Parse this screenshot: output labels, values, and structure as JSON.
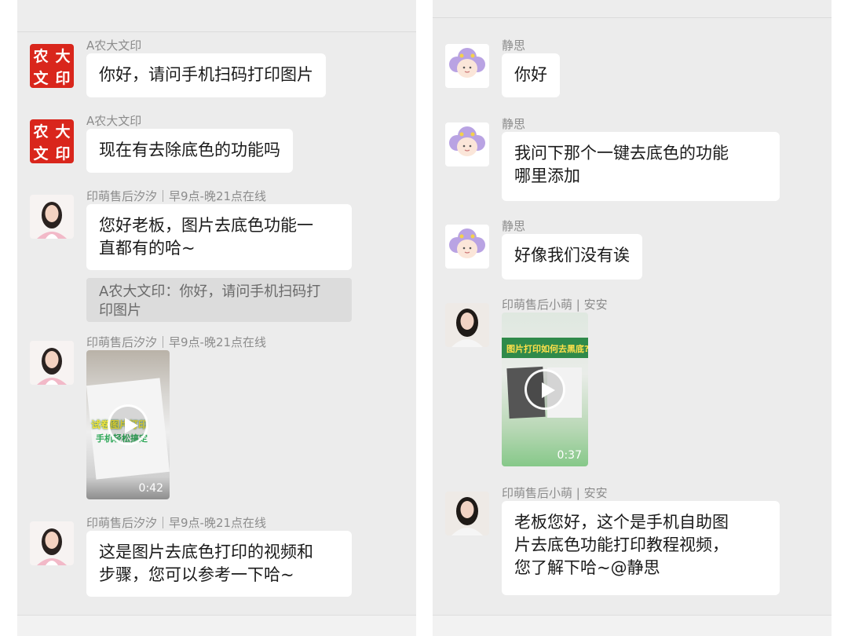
{
  "left_chat": {
    "messages": [
      {
        "sender": "A农大文印",
        "text": "你好，请问手机扫码打印图片"
      },
      {
        "sender": "A农大文印",
        "text": "现在有去除底色的功能吗"
      },
      {
        "sender": "印萌售后汐汐｜早9点-晚21点在线",
        "text": "您好老板，图片去底色功能一\n直都有的哈~",
        "quote": "A农大文印：你好，请问手机扫码打\n印图片"
      },
      {
        "sender": "印萌售后汐汐｜早9点-晚21点在线",
        "video": {
          "duration": "0:42",
          "caption_line1": "试卷图片打印",
          "caption_line2": "手机轻松搞定"
        }
      },
      {
        "sender": "印萌售后汐汐｜早9点-晚21点在线",
        "text": "这是图片去底色打印的视频和\n步骤，您可以参考一下哈~"
      }
    ],
    "logo_chars": [
      "农",
      "大",
      "文",
      "印"
    ]
  },
  "right_chat": {
    "messages": [
      {
        "sender": "静思",
        "text": "你好"
      },
      {
        "sender": "静思",
        "text": "我问下那个一键去底色的功能\n哪里添加"
      },
      {
        "sender": "静思",
        "text": "好像我们没有诶"
      },
      {
        "sender": "印萌售后小萌 | 安安",
        "video": {
          "duration": "0:37",
          "caption": "图片打印如何去黑底?"
        }
      },
      {
        "sender": "印萌售后小萌 | 安安",
        "text": "老板您好，这个是手机自助图\n片去底色功能打印教程视频，\n您了解下哈~@静思"
      }
    ]
  },
  "colors": {
    "logo_red": "#d9261c",
    "bubble": "#ffffff",
    "chat_bg": "#ececec"
  }
}
